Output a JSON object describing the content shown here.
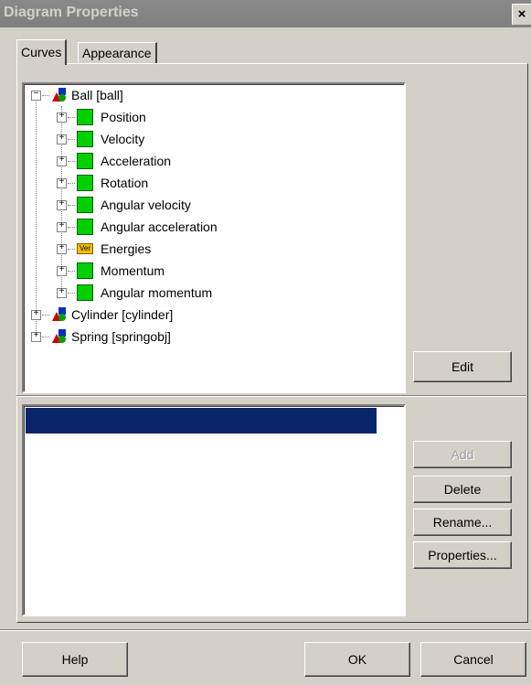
{
  "window": {
    "title": "Diagram Properties",
    "close_label": "×"
  },
  "tabs": [
    {
      "label": "Curves"
    },
    {
      "label": "Appearance"
    }
  ],
  "tree": {
    "items": [
      {
        "label": "Ball  [ball]",
        "expander": "−"
      },
      {
        "label": "Position",
        "expander": "+"
      },
      {
        "label": "Velocity",
        "expander": "+"
      },
      {
        "label": "Acceleration",
        "expander": "+"
      },
      {
        "label": "Rotation",
        "expander": "+"
      },
      {
        "label": "Angular velocity",
        "expander": "+"
      },
      {
        "label": "Angular acceleration",
        "expander": "+"
      },
      {
        "label": "Energies",
        "expander": "+"
      },
      {
        "label": "Momentum",
        "expander": "+"
      },
      {
        "label": "Angular momentum",
        "expander": "+"
      },
      {
        "label": "Cylinder  [cylinder]",
        "expander": "+"
      },
      {
        "label": "Spring  [springobj]",
        "expander": "+"
      }
    ],
    "energy_icon_text": "Ver"
  },
  "buttons": {
    "edit": "Edit",
    "add": "Add",
    "delete": "Delete",
    "rename": "Rename...",
    "properties": "Properties...",
    "help": "Help",
    "ok": "OK",
    "cancel": "Cancel"
  }
}
